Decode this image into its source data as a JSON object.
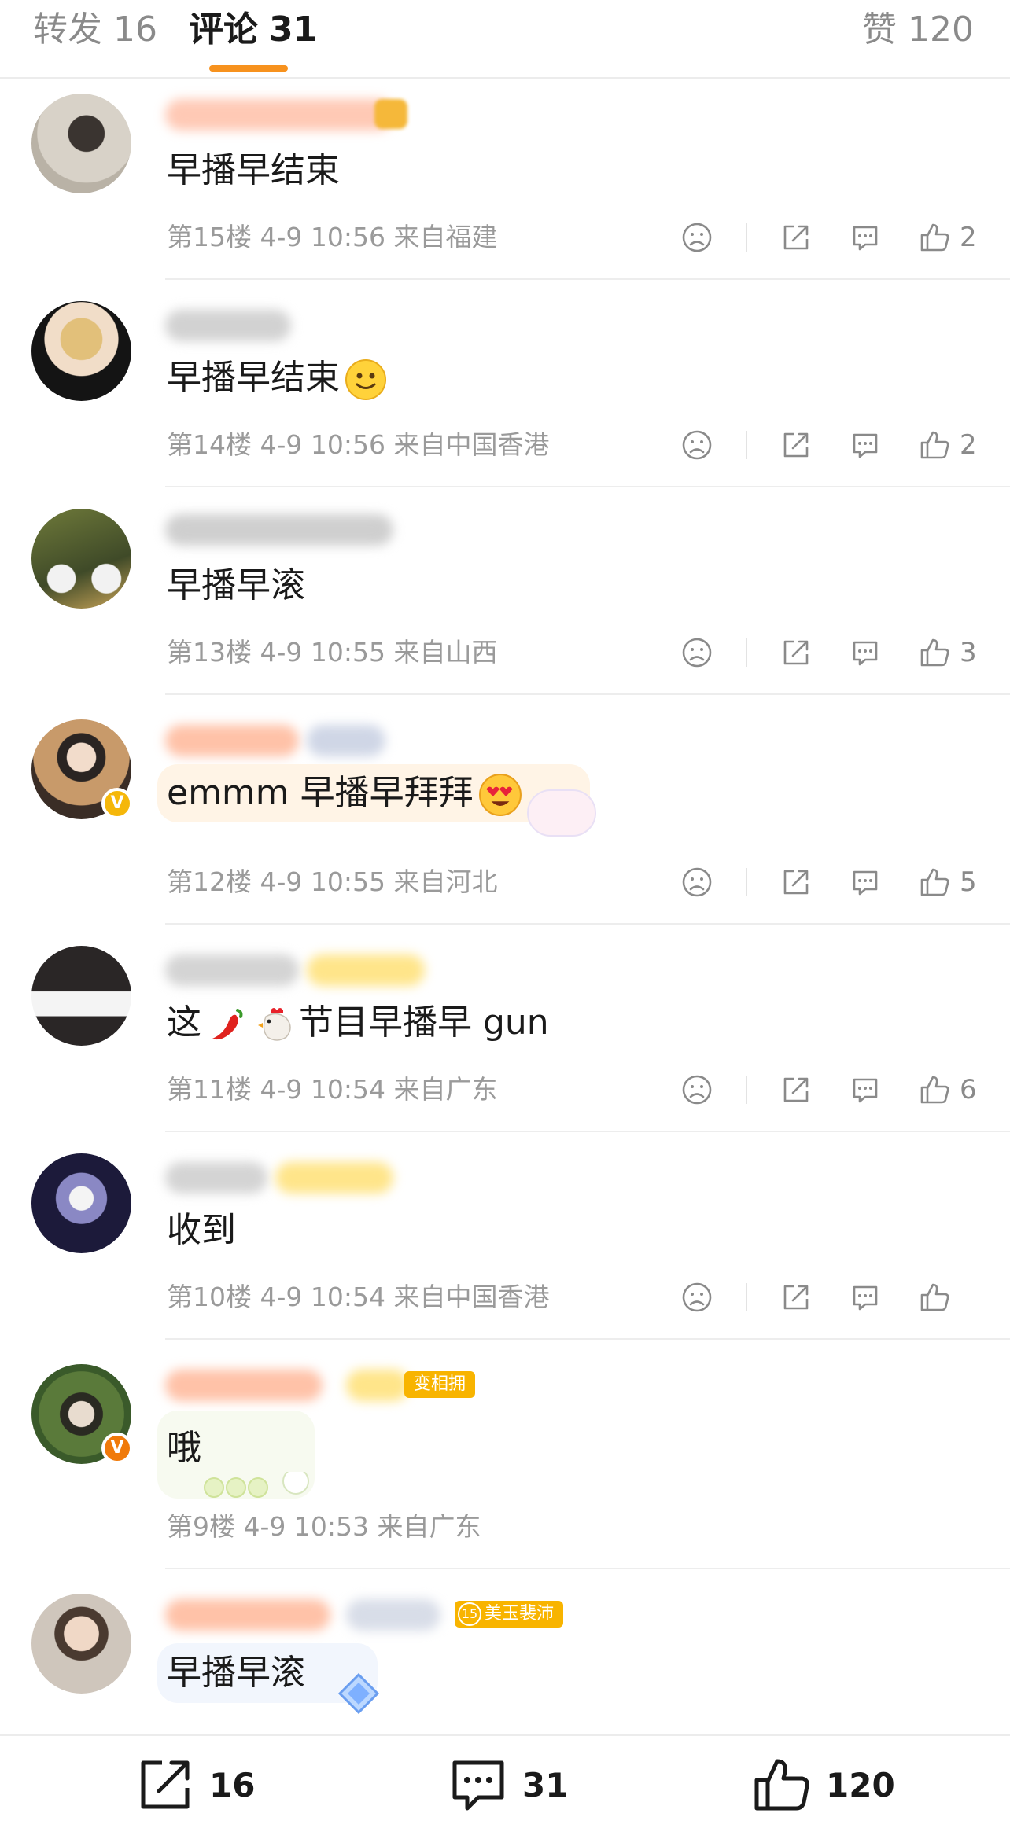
{
  "tabs": {
    "repost_label": "转发",
    "repost_count": "16",
    "comment_label": "评论",
    "comment_count": "31",
    "like_label": "赞",
    "like_count": "120",
    "accent_color": "#f7921e"
  },
  "comments": [
    {
      "text": "早播早结束",
      "floor": "第15楼",
      "date": "4-9",
      "time": "10:56",
      "location": "来自福建",
      "likes": "2"
    },
    {
      "text": "早播早结束",
      "floor": "第14楼",
      "date": "4-9",
      "time": "10:56",
      "location": "来自中国香港",
      "likes": "2"
    },
    {
      "text": "早播早滚",
      "floor": "第13楼",
      "date": "4-9",
      "time": "10:55",
      "location": "来自山西",
      "likes": "3"
    },
    {
      "text": "emmm 早播早拜拜",
      "floor": "第12楼",
      "date": "4-9",
      "time": "10:55",
      "location": "来自河北",
      "likes": "5"
    },
    {
      "text_a": "这",
      "text_b": "节目早播早 gun",
      "floor": "第11楼",
      "date": "4-9",
      "time": "10:54",
      "location": "来自广东",
      "likes": "6"
    },
    {
      "text": "收到",
      "floor": "第10楼",
      "date": "4-9",
      "time": "10:54",
      "location": "来自中国香港",
      "likes": ""
    },
    {
      "text": "哦",
      "floor": "第9楼",
      "date": "4-9",
      "time": "10:53",
      "location": "来自广东",
      "badge": "变相拥"
    },
    {
      "text": "早播早滚",
      "badge_level": "15",
      "badge": "美玉裴沛"
    }
  ],
  "bottom": {
    "repost": "16",
    "comment": "31",
    "like": "120"
  },
  "icons": [
    "dislike-icon",
    "share-icon",
    "reply-icon",
    "thumbs-up-icon",
    "verified-icon"
  ]
}
